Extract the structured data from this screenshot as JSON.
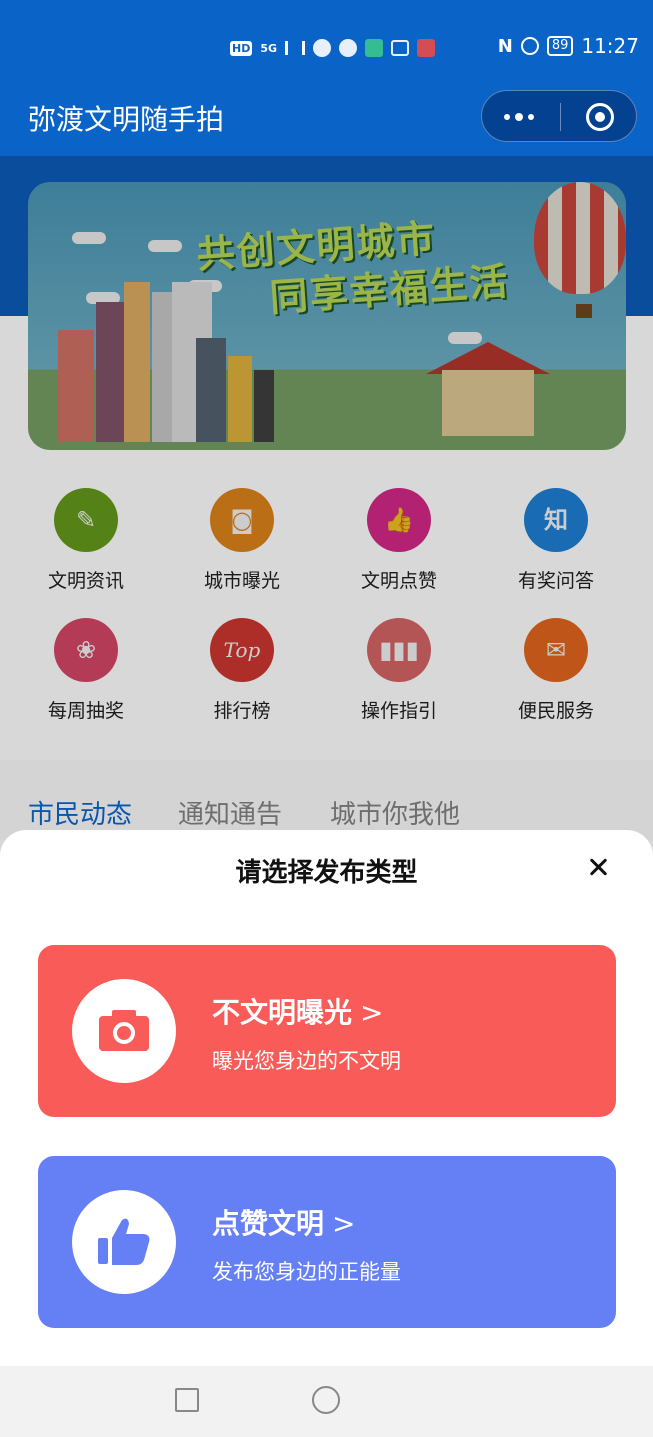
{
  "status_bar": {
    "time": "11:27",
    "battery": "89",
    "network": "5G",
    "hd": "HD",
    "nfc": "N"
  },
  "header": {
    "title": "弥渡文明随手拍"
  },
  "banner": {
    "slogan_line1": "共创文明城市",
    "slogan_line2": "同享幸福生活"
  },
  "menu": {
    "items": [
      {
        "label": "文明资讯",
        "icon": "notepad-icon",
        "color": "#6aa21c"
      },
      {
        "label": "城市曝光",
        "icon": "camera-icon",
        "color": "#e88a1a"
      },
      {
        "label": "文明点赞",
        "icon": "thumbs-up-icon",
        "color": "#e0298f"
      },
      {
        "label": "有奖问答",
        "icon": "knowledge-icon",
        "color": "#1f86e0",
        "glyph": "知"
      },
      {
        "label": "每周抽奖",
        "icon": "gift-basket-icon",
        "color": "#e04a6a"
      },
      {
        "label": "排行榜",
        "icon": "top-ranking-icon",
        "color": "#d83a32",
        "glyph": "Top"
      },
      {
        "label": "操作指引",
        "icon": "bar-chart-icon",
        "color": "#e06a6a"
      },
      {
        "label": "便民服务",
        "icon": "envelope-heart-icon",
        "color": "#f06a1f"
      }
    ]
  },
  "tabs": [
    {
      "label": "市民动态",
      "active": true
    },
    {
      "label": "通知通告",
      "active": false
    },
    {
      "label": "城市你我他",
      "active": false
    }
  ],
  "sheet": {
    "title": "请选择发布类型",
    "options": [
      {
        "title": "不文明曝光",
        "arrow": ">",
        "subtitle": "曝光您身边的不文明",
        "icon": "camera-icon",
        "color": "#f95c58"
      },
      {
        "title": "点赞文明",
        "arrow": ">",
        "subtitle": "发布您身边的正能量",
        "icon": "thumbs-up-icon",
        "color": "#657ff4"
      }
    ]
  }
}
